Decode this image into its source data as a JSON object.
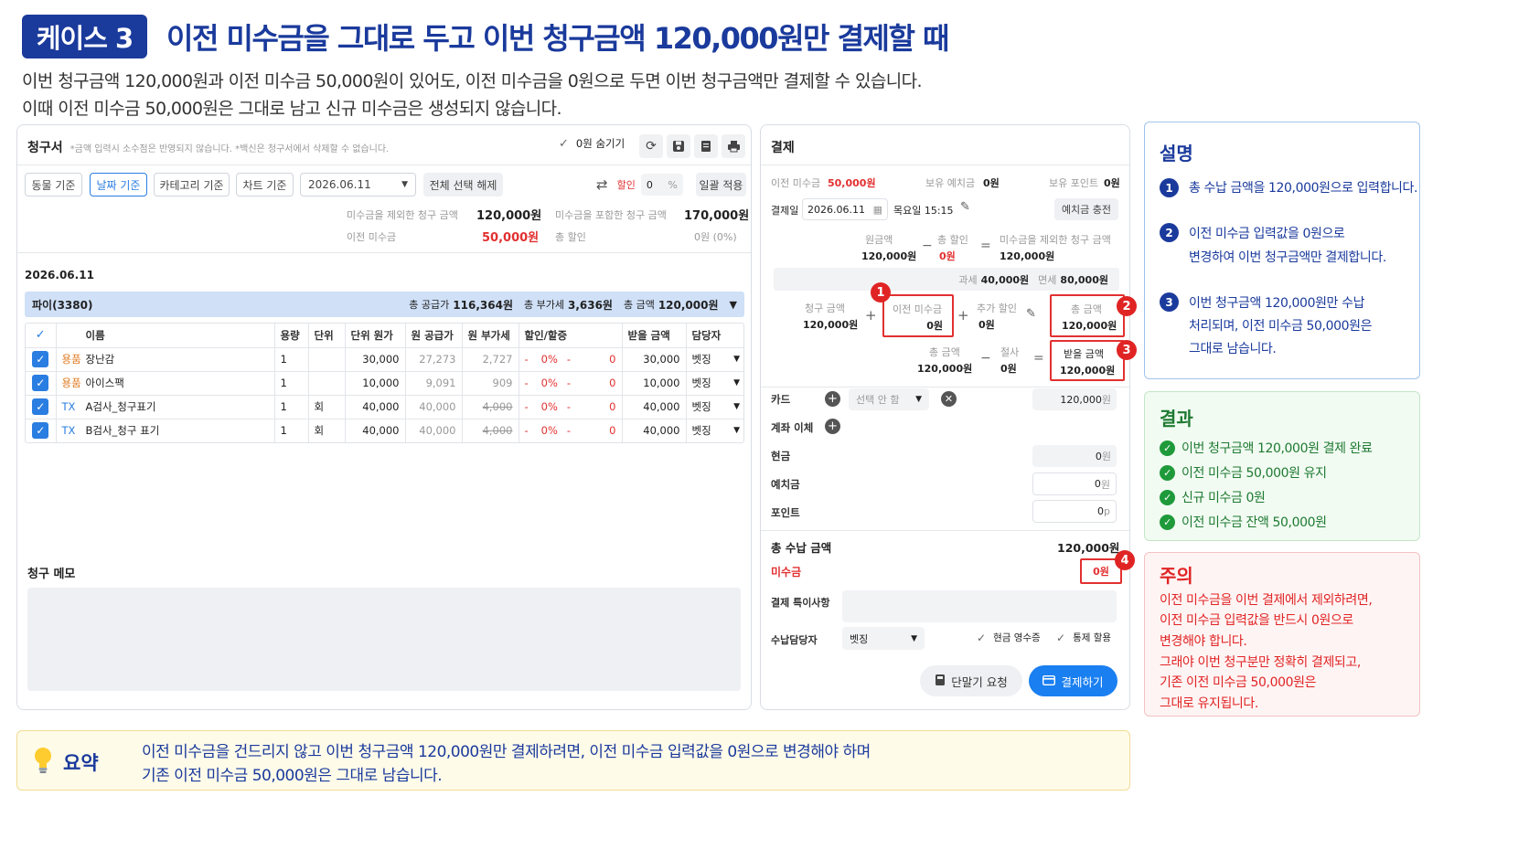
{
  "header": {
    "badge": "케이스 3",
    "title": "이전 미수금을 그대로 두고 이번 청구금액 120,000원만 결제할 때",
    "desc1": "이번 청구금액 120,000원과 이전 미수금 50,000원이 있어도, 이전 미수금을 0원으로 두면 이번 청구금액만 결제할 수 있습니다.",
    "desc2": "이때 이전 미수금 50,000원은 그대로 남고 신규 미수금은 생성되지 않습니다."
  },
  "invoice": {
    "title": "청구서",
    "note": "*금액 입력시 소수점은 반영되지 않습니다. *백신은 청구서에서 삭제할 수 없습니다.",
    "hide_zero": "0원 숨기기",
    "filters": [
      "동물 기준",
      "날짜 기준",
      "카테고리 기준",
      "차트 기준"
    ],
    "date": "2026.06.11",
    "deselect_all": "전체 선택 해제",
    "discount_label": "할인",
    "discount_value": "0",
    "percent": "%",
    "apply_all": "일괄 적용",
    "summary": {
      "excl_label": "미수금을 제외한 청구 금액",
      "excl_value": "120,000원",
      "incl_label": "미수금을 포함한 청구 금액",
      "incl_value": "170,000원",
      "prev_label": "이전 미수금",
      "prev_value": "50,000원",
      "disc_label": "총 할인",
      "disc_value": "0원 (0%)"
    },
    "group_date": "2026.06.11",
    "group_pet": "파이(3380)",
    "group_supply_label": "총 공급가",
    "group_supply": "116,364원",
    "group_vat_label": "총 부가세",
    "group_vat": "3,636원",
    "group_total_label": "총 금액",
    "group_total": "120,000원",
    "columns": [
      "이름",
      "용량",
      "단위",
      "단위 원가",
      "원 공급가",
      "원 부가세",
      "할인/할증",
      "받을 금액",
      "담당자"
    ],
    "rows": [
      {
        "type": "용품",
        "name": "장난감",
        "qty": "1",
        "unit": "",
        "unit_price": "30,000",
        "supply": "27,273",
        "vat": "2,727",
        "dash1": "-",
        "pct": "0%",
        "dash2": "-",
        "disc": "0",
        "amount": "30,000",
        "staff": "벳징"
      },
      {
        "type": "용품",
        "name": "아이스팩",
        "qty": "1",
        "unit": "",
        "unit_price": "10,000",
        "supply": "9,091",
        "vat": "909",
        "dash1": "-",
        "pct": "0%",
        "dash2": "-",
        "disc": "0",
        "amount": "10,000",
        "staff": "벳징"
      },
      {
        "type": "TX",
        "name": "A검사_청구표기",
        "qty": "1",
        "unit": "회",
        "unit_price": "40,000",
        "supply": "40,000",
        "vat": "4,000",
        "dash1": "-",
        "pct": "0%",
        "dash2": "-",
        "disc": "0",
        "amount": "40,000",
        "staff": "벳징"
      },
      {
        "type": "TX",
        "name": "B검사_청구 표기",
        "qty": "1",
        "unit": "회",
        "unit_price": "40,000",
        "supply": "40,000",
        "vat": "4,000",
        "dash1": "-",
        "pct": "0%",
        "dash2": "-",
        "disc": "0",
        "amount": "40,000",
        "staff": "벳징"
      }
    ],
    "memo_label": "청구 메모"
  },
  "payment": {
    "title": "결제",
    "prev_label": "이전 미수금",
    "prev_value": "50,000원",
    "deposit_label": "보유 예치금",
    "deposit_value": "0원",
    "points_label": "보유 포인트",
    "points_value": "0원",
    "date_label": "결제일",
    "date_value": "2026.06.11",
    "weekday_time": "목요일 15:15",
    "charge_deposit": "예치금 충전",
    "orig_label": "원금액",
    "orig_value": "120,000원",
    "tdisc_label": "총 할인",
    "tdisc_value": "0원",
    "excl_label": "미수금을 제외한 청구 금액",
    "excl_value": "120,000원",
    "taxed_label": "과세",
    "taxed_value": "40,000원",
    "exempt_label": "면세",
    "exempt_value": "80,000원",
    "bill_label": "청구 금액",
    "bill_value": "120,000원",
    "prevbox_label": "이전 미수금",
    "prevbox_value": "0원",
    "extra_label": "추가 할인",
    "extra_value": "0원",
    "total_label": "총 금액",
    "total_value": "120,000원",
    "total2_label": "총 금액",
    "total2_value": "120,000원",
    "cut_label": "절사",
    "cut_value": "0원",
    "recv_label": "받을 금액",
    "recv_value": "120,000원",
    "card_label": "카드",
    "card_select": "선택 안 함",
    "card_amount": "120,000",
    "won": "원",
    "transfer_label": "계좌 이체",
    "cash_label": "현금",
    "cash_value": "0",
    "depo_label": "예치금",
    "depo_value": "0",
    "point_label": "포인트",
    "point_value": "0",
    "point_unit": "p",
    "total_recv_label": "총 수납 금액",
    "total_recv_value": "120,000원",
    "unpaid_label": "미수금",
    "unpaid_value": "0원",
    "notes_label": "결제 특이사항",
    "staff_label": "수납담당자",
    "staff_value": "벳징",
    "cash_receipt": "현금 영수증",
    "combined": "통제 할용",
    "terminal_btn": "단말기 요청",
    "pay_btn": "결제하기",
    "markers": [
      "1",
      "2",
      "3",
      "4"
    ]
  },
  "explain": {
    "title": "설명",
    "items": [
      {
        "num": "1",
        "text": "총 수납 금액을 120,000원으로 입력합니다."
      },
      {
        "num": "2",
        "line1": "이전 미수금 입력값을 0원으로",
        "line2": "변경하여 이번 청구금액만 결제합니다."
      },
      {
        "num": "3",
        "line1": "이번 청구금액 120,000원만 수납",
        "line2": "처리되며, 이전 미수금 50,000원은",
        "line3": "그대로 남습니다."
      }
    ]
  },
  "result": {
    "title": "결과",
    "items": [
      "이번 청구금액 120,000원 결제 완료",
      "이전 미수금 50,000원 유지",
      "신규 미수금 0원",
      "이전 미수금 잔액 50,000원"
    ]
  },
  "caution": {
    "title": "주의",
    "lines": [
      "이전 미수금을 이번 결제에서 제외하려면,",
      "이전 미수금 입력값을 반드시 0원으로",
      "변경해야 합니다.",
      "그래야 이번 청구분만 정확히 결제되고,",
      "기존 이전 미수금 50,000원은",
      "그대로 유지됩니다."
    ]
  },
  "summary": {
    "label": "요약",
    "line1": "이전 미수금을 건드리지 않고 이번 청구금액 120,000원만 결제하려면, 이전 미수금 입력값을 0원으로 변경해야 하며",
    "line2": "기존 이전 미수금 50,000원은 그대로 남습니다."
  },
  "colors": {
    "navy": "#1a3a9c",
    "accent": "#2a7de1",
    "red": "#e23030",
    "green": "#1f9a3a"
  }
}
